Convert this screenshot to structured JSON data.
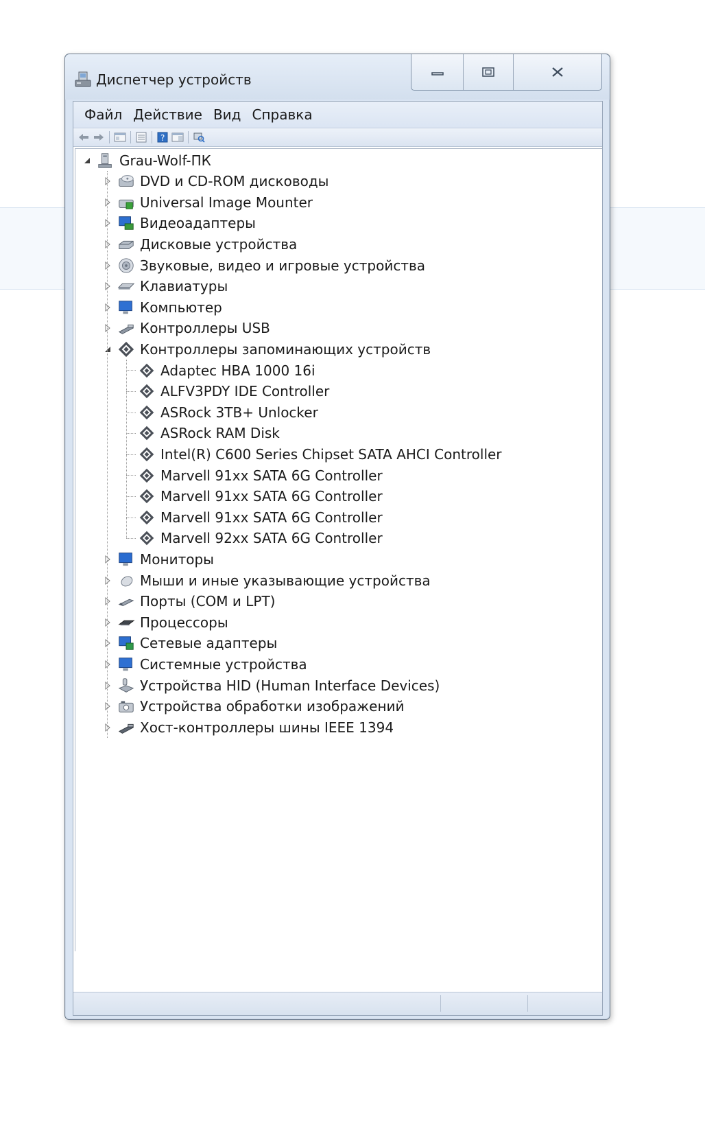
{
  "window": {
    "title": "Диспетчер устройств",
    "icon": "device-manager-icon"
  },
  "menu": [
    "Файл",
    "Действие",
    "Вид",
    "Справка"
  ],
  "toolbar": [
    "back-arrow-icon",
    "forward-arrow-icon",
    "show-hide-console-tree-icon",
    "properties-icon",
    "help-icon",
    "action-pane-icon",
    "scan-hardware-icon"
  ],
  "tree": {
    "root": {
      "label": "Grau-Wolf-ПК",
      "icon": "computer-icon",
      "expanded": true
    },
    "categories": [
      {
        "label": "DVD и CD-ROM дисководы",
        "icon": "dvd-drive-icon"
      },
      {
        "label": "Universal Image Mounter",
        "icon": "image-mounter-icon"
      },
      {
        "label": "Видеоадаптеры",
        "icon": "display-adapter-icon"
      },
      {
        "label": "Дисковые устройства",
        "icon": "disk-drive-icon"
      },
      {
        "label": "Звуковые, видео и игровые устройства",
        "icon": "sound-icon"
      },
      {
        "label": "Клавиатуры",
        "icon": "keyboard-icon"
      },
      {
        "label": "Компьютер",
        "icon": "computer-monitor-icon"
      },
      {
        "label": "Контроллеры USB",
        "icon": "usb-icon"
      },
      {
        "label": "Контроллеры запоминающих устройств",
        "icon": "storage-controller-icon",
        "expanded": true,
        "children": [
          "Adaptec HBA 1000 16i",
          "ALFV3PDY IDE Controller",
          "ASRock 3TB+ Unlocker",
          "ASRock RAM Disk",
          "Intel(R) C600 Series Chipset SATA AHCI Controller",
          "Marvell 91xx SATA 6G Controller",
          "Marvell 91xx SATA 6G Controller",
          "Marvell 91xx SATA 6G Controller",
          "Marvell 92xx SATA 6G Controller"
        ]
      },
      {
        "label": "Мониторы",
        "icon": "monitor-icon"
      },
      {
        "label": "Мыши и иные указывающие устройства",
        "icon": "mouse-icon"
      },
      {
        "label": "Порты (COM и LPT)",
        "icon": "port-icon"
      },
      {
        "label": "Процессоры",
        "icon": "processor-icon"
      },
      {
        "label": "Сетевые адаптеры",
        "icon": "network-adapter-icon"
      },
      {
        "label": "Системные устройства",
        "icon": "system-devices-icon"
      },
      {
        "label": "Устройства HID (Human Interface Devices)",
        "icon": "hid-icon"
      },
      {
        "label": "Устройства обработки изображений",
        "icon": "imaging-device-icon"
      },
      {
        "label": "Хост-контроллеры шины IEEE 1394",
        "icon": "ieee1394-icon"
      }
    ]
  }
}
